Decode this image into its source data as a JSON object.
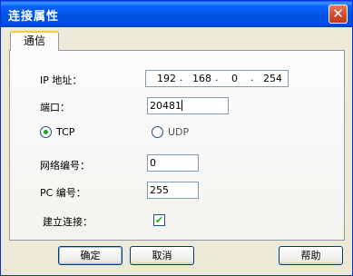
{
  "window": {
    "title": "连接属性",
    "close_glyph": "✕"
  },
  "tabs": [
    {
      "label": "通信",
      "active": true
    }
  ],
  "form": {
    "ip_label": "IP 地址：",
    "ip_octets": [
      "192",
      "168",
      "0",
      "254"
    ],
    "ip_dot": ".",
    "port_label": "端口：",
    "port_value": "20481",
    "protocol": {
      "tcp_label": "TCP",
      "udp_label": "UDP",
      "selected": "TCP"
    },
    "network_no_label": "网络编号：",
    "network_no_value": "0",
    "pc_no_label": "PC 编号：",
    "pc_no_value": "255",
    "connect_label": "建立连接：",
    "connect_checked": true,
    "check_glyph": "✔"
  },
  "buttons": {
    "ok": "确定",
    "cancel": "取消",
    "help": "帮助"
  },
  "colors": {
    "titlebar": "#0054e3",
    "close": "#d34a2b",
    "radio_dot": "#21a121",
    "tab_highlight": "#ffc73c"
  },
  "icons": {
    "close": "close-icon",
    "radio": "radio-dot-icon",
    "check": "check-icon"
  }
}
